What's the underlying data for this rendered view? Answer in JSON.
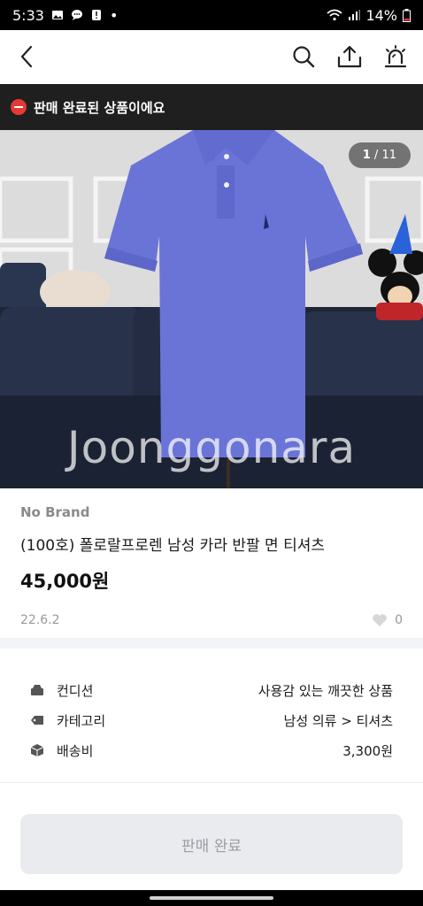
{
  "status_bar": {
    "time": "5:33",
    "battery": "14%",
    "dot": "•"
  },
  "nav": {
    "back_icon": "chevron-left-icon",
    "search_icon": "search-icon",
    "share_icon": "share-icon",
    "report_icon": "siren-icon"
  },
  "banner": {
    "text": "판매 완료된 상품이에요"
  },
  "gallery": {
    "current": "1",
    "total": "11",
    "separator": "/",
    "watermark": "Joonggonara"
  },
  "product": {
    "brand": "No Brand",
    "title": "(100호) 폴로랄프로렌 남성 카라 반팔 면 티셔츠",
    "price": "45,000원",
    "date": "22.6.2",
    "likes": "0"
  },
  "details": [
    {
      "label": "컨디션",
      "value": "사용감 있는 깨끗한 상품",
      "icon": "condition-icon"
    },
    {
      "label": "카테고리",
      "value": "남성 의류 > 티셔츠",
      "icon": "tag-icon"
    },
    {
      "label": "배송비",
      "value": "3,300원",
      "icon": "box-icon"
    }
  ],
  "bottom": {
    "button_label": "판매 완료"
  }
}
